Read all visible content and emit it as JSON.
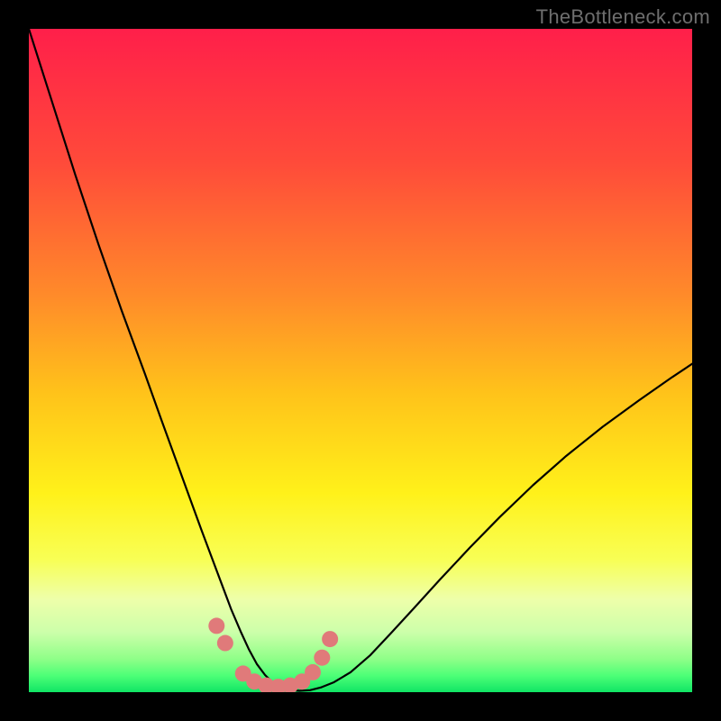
{
  "watermark": "TheBottleneck.com",
  "chart_data": {
    "type": "line",
    "title": "",
    "xlabel": "",
    "ylabel": "",
    "xlim": [
      0,
      100
    ],
    "ylim": [
      0,
      100
    ],
    "grid": false,
    "legend": false,
    "background_gradient": {
      "stops": [
        {
          "offset": 0.0,
          "color": "#ff1f4a"
        },
        {
          "offset": 0.2,
          "color": "#ff4a3a"
        },
        {
          "offset": 0.4,
          "color": "#ff8a2a"
        },
        {
          "offset": 0.55,
          "color": "#ffc31a"
        },
        {
          "offset": 0.7,
          "color": "#fff11a"
        },
        {
          "offset": 0.8,
          "color": "#f8ff55"
        },
        {
          "offset": 0.86,
          "color": "#eeffaa"
        },
        {
          "offset": 0.91,
          "color": "#ccffaa"
        },
        {
          "offset": 0.95,
          "color": "#8fff88"
        },
        {
          "offset": 0.975,
          "color": "#4dff77"
        },
        {
          "offset": 1.0,
          "color": "#10e565"
        }
      ]
    },
    "series": [
      {
        "name": "bottleneck-curve",
        "color": "#000000",
        "stroke_width": 2.2,
        "x": [
          0.0,
          3.5,
          7.0,
          10.5,
          14.0,
          17.5,
          20.0,
          22.0,
          24.0,
          26.0,
          27.5,
          29.0,
          30.5,
          32.0,
          33.2,
          34.4,
          35.6,
          36.8,
          38.0,
          39.4,
          40.8,
          42.4,
          44.0,
          46.0,
          48.5,
          51.5,
          54.5,
          58.0,
          62.0,
          66.5,
          71.0,
          76.0,
          81.0,
          86.5,
          92.0,
          97.0,
          100.0
        ],
        "values": [
          100.0,
          89.0,
          78.0,
          67.5,
          57.5,
          48.0,
          41.0,
          35.5,
          30.0,
          24.5,
          20.5,
          16.5,
          12.5,
          9.0,
          6.4,
          4.2,
          2.6,
          1.4,
          0.7,
          0.3,
          0.2,
          0.3,
          0.7,
          1.5,
          3.0,
          5.6,
          8.8,
          12.6,
          17.0,
          21.8,
          26.4,
          31.2,
          35.6,
          40.0,
          44.0,
          47.5,
          49.5
        ]
      }
    ],
    "inflection_markers": {
      "color": "#e07a7a",
      "radius_px": 9,
      "points": [
        {
          "x": 28.3,
          "y": 10.0
        },
        {
          "x": 29.6,
          "y": 7.4
        },
        {
          "x": 32.3,
          "y": 2.8
        },
        {
          "x": 34.0,
          "y": 1.6
        },
        {
          "x": 35.8,
          "y": 1.0
        },
        {
          "x": 37.6,
          "y": 0.8
        },
        {
          "x": 39.4,
          "y": 1.0
        },
        {
          "x": 41.2,
          "y": 1.6
        },
        {
          "x": 42.8,
          "y": 3.0
        },
        {
          "x": 44.2,
          "y": 5.2
        },
        {
          "x": 45.4,
          "y": 8.0
        }
      ]
    }
  }
}
